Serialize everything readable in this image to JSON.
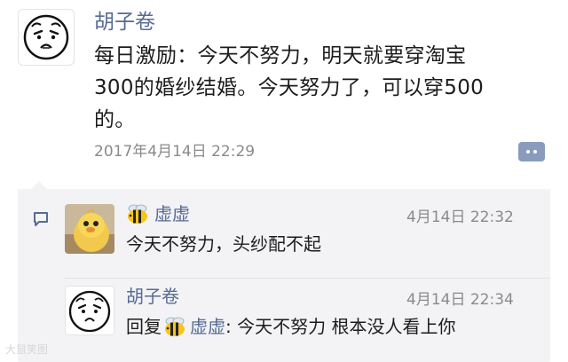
{
  "post": {
    "author": "胡子卷",
    "text_lines": [
      "每日激励：今天不努力，明天就要穿淘宝",
      "300的婚纱结婚。今天努力了，可以穿500",
      "的。"
    ],
    "timestamp": "2017年4月14日 22:29"
  },
  "comments": [
    {
      "author": "虚虚",
      "time": "4月14日 22:32",
      "text": "今天不努力，头纱配不起"
    },
    {
      "author": "胡子卷",
      "time": "4月14日 22:34",
      "reply_prefix": "回复",
      "reply_to": "虚虚",
      "text": ": 今天不努力 根本没人看上你"
    }
  ],
  "watermark": "大鼠笑图",
  "colors": {
    "name": "#576b95",
    "comment_bg": "#f3f3f5",
    "more_button": "#8a9bbd"
  },
  "icons": [
    "sad-face-avatar",
    "chick-avatar",
    "bee-icon",
    "comment-icon",
    "more-dots-icon"
  ]
}
